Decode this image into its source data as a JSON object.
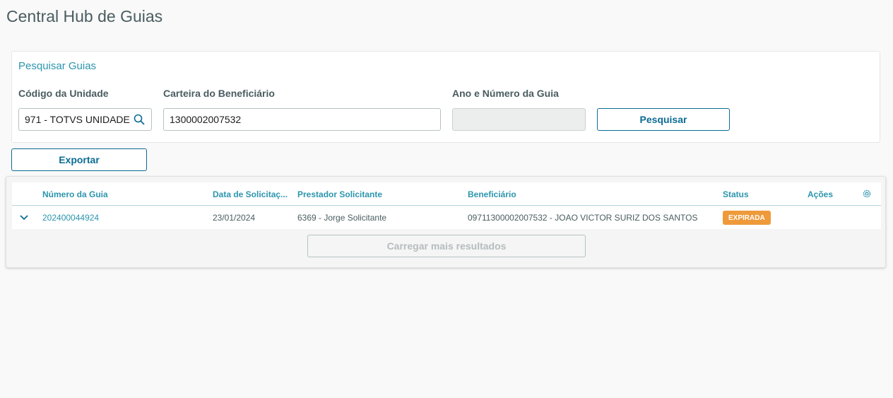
{
  "page": {
    "title": "Central Hub de Guias"
  },
  "search": {
    "title": "Pesquisar Guias",
    "unit_label": "Código da Unidade",
    "unit_value": "971 - TOTVS UNIDADE",
    "card_label": "Carteira do Beneficiário",
    "card_value": "1300002007532",
    "guide_label": "Ano e Número da Guia",
    "guide_value": "",
    "search_button": "Pesquisar"
  },
  "toolbar": {
    "export_button": "Exportar"
  },
  "table": {
    "columns": {
      "guide_number": "Número da Guia",
      "request_date": "Data de Solicitaç...",
      "provider": "Prestador Solicitante",
      "beneficiary": "Beneficiário",
      "status": "Status",
      "actions": "Ações"
    },
    "rows": [
      {
        "guide_number": "202400044924",
        "request_date": "23/01/2024",
        "provider": "6369 - Jorge Solicitante",
        "beneficiary": "09711300002007532 - JOAO VICTOR SURIZ DOS SANTOS",
        "status": "EXPIRADA",
        "status_color": "#ee9a3b"
      }
    ],
    "load_more": "Carregar mais resultados"
  },
  "icons": {
    "lookup": "search-icon",
    "expand": "chevron-down-icon",
    "settings": "gear-icon"
  },
  "colors": {
    "accent": "#2c95ad",
    "primary_button": "#0c6c94",
    "status_expired": "#ee9a3b"
  }
}
